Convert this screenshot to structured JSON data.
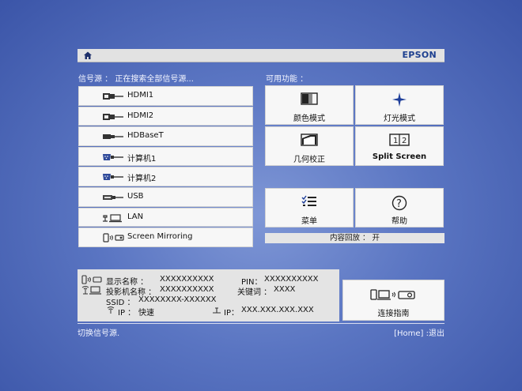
{
  "header": {
    "brand": "EPSON"
  },
  "source_status": {
    "text": "信号源 ： 正在搜索全部信号源..."
  },
  "functions_heading": "可用功能 ：",
  "sources": [
    {
      "label": "HDMI1",
      "icon": "hdmi-icon"
    },
    {
      "label": "HDMI2",
      "icon": "hdmi-icon"
    },
    {
      "label": "HDBaseT",
      "icon": "hdbaset-icon"
    },
    {
      "label": "计算机1",
      "icon": "vga-computer-icon"
    },
    {
      "label": "计算机2",
      "icon": "vga-computer-icon"
    },
    {
      "label": "USB",
      "icon": "usb-icon"
    },
    {
      "label": "LAN",
      "icon": "lan-icon"
    },
    {
      "label": "Screen Mirroring",
      "icon": "screen-mirroring-icon"
    }
  ],
  "functions": [
    {
      "label": "颜色模式",
      "icon": "color-mode-icon"
    },
    {
      "label": "灯光模式",
      "icon": "light-mode-icon"
    },
    {
      "label": "几何校正",
      "icon": "geometry-correction-icon"
    },
    {
      "label": "Split Screen",
      "icon": "split-screen-icon"
    },
    {
      "label": "菜单",
      "icon": "menu-icon"
    },
    {
      "label": "帮助",
      "icon": "help-icon"
    }
  ],
  "content_playback": "内容回放 ： 开",
  "network": {
    "display_name_label": "显示名称 ：",
    "display_name_value": "XXXXXXXXXX",
    "pin_label": "PIN：",
    "pin_value": "XXXXXXXXXX",
    "projector_name_label": "投影机名称 ：",
    "projector_name_value": "XXXXXXXXXX",
    "keyword_label": "关键词 ：",
    "keyword_value": "XXXX",
    "ssid_label": "SSID ：",
    "ssid_value": "XXXXXXXX-XXXXXX",
    "wireless_ip_label": "IP ：",
    "wireless_ip_value": "快速",
    "wired_ip_label": "IP：",
    "wired_ip_value": "XXX.XXX.XXX.XXX"
  },
  "connection_guide": {
    "label": "连接指南"
  },
  "footer": {
    "left": "切换信号源.",
    "right": "[Home] :退出"
  }
}
